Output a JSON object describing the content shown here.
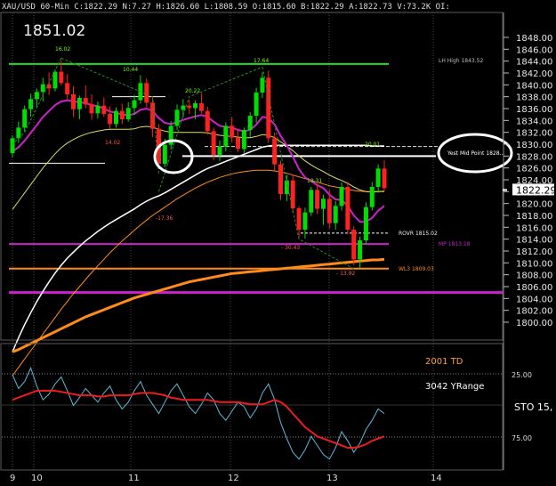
{
  "header": {
    "text": "XAU/USD 60-Min C:1822.29 N:7.27 H:1826.60 L:1808.59 O:1815.60 B:1822.29 A:1822.73 V:73.2K OI: ",
    "big_price": "1851.02"
  },
  "colors": {
    "background": "#000000",
    "candle_up": "#00dd00",
    "candle_down": "#ff2020",
    "price_label_bg": "#ffffff",
    "magenta": "#cc22cc",
    "green_line": "#22dd22",
    "orange": "#ff8c1a"
  },
  "chart_data": [
    {
      "type": "line",
      "ylim": [
        1798,
        1849
      ],
      "y_ticks": [
        "1848.00",
        "1846.00",
        "1844.00",
        "1842.00",
        "1840.00",
        "1838.00",
        "1836.00",
        "1834.00",
        "1832.00",
        "1830.00",
        "1828.00",
        "1826.00",
        "1824.00",
        "1822.00",
        "1820.00",
        "1818.00",
        "1816.00",
        "1814.00",
        "1812.00",
        "1810.00",
        "1808.00",
        "1806.00",
        "1804.00",
        "1802.00",
        "1800.00"
      ],
      "current_price": "1822.29",
      "x_ticks": [
        "9",
        "10",
        "11",
        "12",
        "13",
        "14"
      ],
      "candles": [
        [
          1828.5,
          1831.5,
          1827.8,
          1831.0
        ],
        [
          1831.0,
          1833.8,
          1830.2,
          1832.8
        ],
        [
          1832.8,
          1836.5,
          1832.1,
          1835.9
        ],
        [
          1835.9,
          1838.5,
          1834.6,
          1837.6
        ],
        [
          1837.6,
          1839.4,
          1836.1,
          1838.8
        ],
        [
          1838.8,
          1841.2,
          1837.2,
          1840.1
        ],
        [
          1840.1,
          1842.1,
          1838.3,
          1839.4
        ],
        [
          1839.4,
          1842.6,
          1838.9,
          1842.2
        ],
        [
          1842.2,
          1844.1,
          1839.9,
          1840.3
        ],
        [
          1840.3,
          1841.8,
          1837.6,
          1838.4
        ],
        [
          1838.4,
          1839.8,
          1834.6,
          1835.9
        ],
        [
          1835.9,
          1838.2,
          1834.2,
          1837.8
        ],
        [
          1837.8,
          1839.9,
          1836.1,
          1836.7
        ],
        [
          1836.7,
          1838.4,
          1834.1,
          1835.2
        ],
        [
          1835.2,
          1837.2,
          1834.3,
          1836.5
        ],
        [
          1836.5,
          1837.9,
          1834.6,
          1835.1
        ],
        [
          1835.1,
          1836.4,
          1832.6,
          1833.4
        ],
        [
          1833.4,
          1836.2,
          1832.8,
          1835.6
        ],
        [
          1835.6,
          1836.8,
          1833.4,
          1834.2
        ],
        [
          1834.2,
          1837.1,
          1833.8,
          1836.1
        ],
        [
          1836.1,
          1838.3,
          1834.9,
          1837.4
        ],
        [
          1837.4,
          1841.6,
          1836.8,
          1840.3
        ],
        [
          1840.3,
          1841.1,
          1836.2,
          1837.0
        ],
        [
          1837.0,
          1838.0,
          1831.2,
          1832.6
        ],
        [
          1832.6,
          1833.4,
          1825.8,
          1826.7
        ],
        [
          1826.7,
          1830.9,
          1826.1,
          1829.9
        ],
        [
          1829.9,
          1833.9,
          1829.1,
          1833.1
        ],
        [
          1833.1,
          1836.7,
          1832.4,
          1835.8
        ],
        [
          1835.8,
          1837.6,
          1834.5,
          1836.5
        ],
        [
          1836.5,
          1837.5,
          1835.1,
          1836.1
        ],
        [
          1836.1,
          1837.4,
          1834.2,
          1836.9
        ],
        [
          1836.9,
          1838.6,
          1835.2,
          1835.6
        ],
        [
          1835.6,
          1836.3,
          1831.6,
          1832.2
        ],
        [
          1832.2,
          1832.8,
          1827.3,
          1828.2
        ],
        [
          1828.2,
          1830.6,
          1827.2,
          1829.6
        ],
        [
          1829.6,
          1833.7,
          1828.8,
          1833.1
        ],
        [
          1833.1,
          1834.6,
          1830.3,
          1831.1
        ],
        [
          1831.1,
          1832.6,
          1828.7,
          1829.2
        ],
        [
          1829.2,
          1832.8,
          1828.5,
          1832.4
        ],
        [
          1832.4,
          1835.4,
          1831.2,
          1834.8
        ],
        [
          1834.8,
          1839.5,
          1833.6,
          1838.7
        ],
        [
          1838.7,
          1842.1,
          1837.8,
          1841.2
        ],
        [
          1841.2,
          1842.4,
          1830.2,
          1831.0
        ],
        [
          1831.0,
          1832.0,
          1825.6,
          1826.6
        ],
        [
          1826.6,
          1827.2,
          1820.6,
          1821.6
        ],
        [
          1821.6,
          1824.8,
          1820.4,
          1823.9
        ],
        [
          1823.9,
          1824.9,
          1818.4,
          1819.2
        ],
        [
          1819.2,
          1819.6,
          1814.3,
          1815.6
        ],
        [
          1815.6,
          1819.3,
          1814.1,
          1818.5
        ],
        [
          1818.5,
          1822.8,
          1817.9,
          1822.3
        ],
        [
          1822.3,
          1823.4,
          1818.2,
          1819.1
        ],
        [
          1819.1,
          1821.5,
          1816.4,
          1820.8
        ],
        [
          1820.8,
          1822.3,
          1815.8,
          1816.7
        ],
        [
          1816.7,
          1820.4,
          1815.6,
          1819.6
        ],
        [
          1819.6,
          1823.6,
          1818.8,
          1822.8
        ],
        [
          1822.8,
          1823.6,
          1814.8,
          1815.6
        ],
        [
          1815.6,
          1816.2,
          1809.6,
          1810.6
        ],
        [
          1810.6,
          1814.4,
          1809.1,
          1813.8
        ],
        [
          1813.8,
          1820.2,
          1813.1,
          1819.4
        ],
        [
          1819.4,
          1823.6,
          1818.8,
          1822.8
        ],
        [
          1822.8,
          1826.6,
          1821.8,
          1825.9
        ],
        [
          1825.9,
          1827.3,
          1822.1,
          1822.6
        ]
      ],
      "indicators": {
        "ma_magenta": [
          1828.8,
          1829.5,
          1830.6,
          1831.9,
          1833.2,
          1834.6,
          1835.6,
          1836.6,
          1837.2,
          1837.4,
          1837.2,
          1837.1,
          1836.9,
          1836.6,
          1836.4,
          1836.0,
          1835.5,
          1835.3,
          1835.0,
          1834.9,
          1835.1,
          1835.8,
          1836.0,
          1835.6,
          1834.4,
          1833.6,
          1833.4,
          1833.7,
          1834.1,
          1834.4,
          1834.7,
          1834.9,
          1834.6,
          1833.8,
          1833.1,
          1832.9,
          1832.8,
          1832.4,
          1832.2,
          1832.4,
          1833.3,
          1834.6,
          1834.4,
          1833.3,
          1831.4,
          1829.8,
          1827.9,
          1825.8,
          1824.4,
          1823.8,
          1823.1,
          1822.6,
          1821.5,
          1820.7,
          1820.6,
          1819.6,
          1818.0,
          1816.9,
          1816.9,
          1817.6,
          1818.8,
          1819.6
        ],
        "ma_yellow": [
          1819.0,
          1820.4,
          1821.8,
          1823.2,
          1824.6,
          1826.0,
          1827.2,
          1828.4,
          1829.4,
          1830.2,
          1830.8,
          1831.3,
          1831.7,
          1832.0,
          1832.2,
          1832.4,
          1832.5,
          1832.5,
          1832.5,
          1832.5,
          1832.6,
          1832.9,
          1833.0,
          1832.9,
          1832.5,
          1832.2,
          1832.0,
          1832.0,
          1832.0,
          1832.0,
          1832.0,
          1832.0,
          1831.9,
          1831.7,
          1831.5,
          1831.4,
          1831.3,
          1831.2,
          1831.1,
          1831.1,
          1831.3,
          1831.6,
          1831.5,
          1831.1,
          1830.4,
          1829.7,
          1828.9,
          1828.0,
          1827.2,
          1826.5,
          1825.9,
          1825.4,
          1824.8,
          1824.3,
          1823.9,
          1823.4,
          1822.8,
          1822.3,
          1822.0,
          1821.9,
          1822.0,
          1822.1
        ],
        "ma_white": [
          1795.0,
          1797.4,
          1799.6,
          1801.6,
          1803.5,
          1805.2,
          1806.8,
          1808.3,
          1809.6,
          1810.8,
          1811.8,
          1812.8,
          1813.7,
          1814.5,
          1815.3,
          1816.0,
          1816.7,
          1817.3,
          1817.9,
          1818.5,
          1819.1,
          1819.8,
          1820.4,
          1820.9,
          1821.3,
          1821.8,
          1822.4,
          1823.0,
          1823.6,
          1824.2,
          1824.8,
          1825.4,
          1825.9,
          1826.3,
          1826.7,
          1827.1,
          1827.5,
          1827.9,
          1828.3,
          1828.7,
          1829.1,
          1829.5,
          1829.7,
          1829.8,
          1829.8,
          1829.8,
          1829.8,
          1829.8,
          1829.8,
          1829.8,
          1829.8,
          1829.8,
          1829.8,
          1829.8,
          1829.8,
          1829.8,
          1829.8,
          1829.8,
          1829.8,
          1829.7,
          1829.7,
          1829.7
        ],
        "ma_orange_thin": [
          1791.0,
          1792.4,
          1793.8,
          1795.2,
          1796.6,
          1798.0,
          1799.4,
          1800.8,
          1802.2,
          1803.5,
          1804.8,
          1806.0,
          1807.2,
          1808.4,
          1809.5,
          1810.6,
          1811.7,
          1812.7,
          1813.7,
          1814.6,
          1815.5,
          1816.4,
          1817.2,
          1818.0,
          1818.7,
          1819.4,
          1820.1,
          1820.8,
          1821.4,
          1822.0,
          1822.6,
          1823.1,
          1823.6,
          1824.0,
          1824.4,
          1824.7,
          1825.0,
          1825.2,
          1825.4,
          1825.5,
          1825.6,
          1825.6,
          1825.6,
          1825.5,
          1825.3,
          1825.1,
          1824.8,
          1824.5,
          1824.2,
          1823.9,
          1823.6,
          1823.3,
          1823.0,
          1822.8,
          1822.6,
          1822.4,
          1822.2,
          1822.1,
          1822.0,
          1822.0,
          1822.0,
          1822.0
        ],
        "ma_orange_thick": [
          1795.0,
          1795.4,
          1795.9,
          1796.4,
          1796.9,
          1797.4,
          1797.9,
          1798.4,
          1798.9,
          1799.4,
          1799.9,
          1800.4,
          1800.9,
          1801.3,
          1801.7,
          1802.1,
          1802.5,
          1802.9,
          1803.3,
          1803.7,
          1804.1,
          1804.4,
          1804.7,
          1805.0,
          1805.3,
          1805.6,
          1805.9,
          1806.2,
          1806.5,
          1806.8,
          1807.0,
          1807.2,
          1807.4,
          1807.6,
          1807.8,
          1808.0,
          1808.2,
          1808.3,
          1808.4,
          1808.5,
          1808.6,
          1808.7,
          1808.8,
          1808.9,
          1809.0,
          1809.1,
          1809.2,
          1809.3,
          1809.4,
          1809.5,
          1809.6,
          1809.7,
          1809.8,
          1809.9,
          1810.0,
          1810.1,
          1810.2,
          1810.3,
          1810.4,
          1810.5,
          1810.5,
          1810.6
        ]
      },
      "levels": [
        {
          "price": 1843.52,
          "label": "LH High 1843.52",
          "color": "#22dd22"
        },
        {
          "price": 1828.0,
          "label": "Yest Mid Point 1828...",
          "color": "#ffffff"
        },
        {
          "price": 1815.02,
          "label": "ROVR 1815.02",
          "color": "#ffffff"
        },
        {
          "price": 1813.18,
          "label": "MP 1813.18",
          "color": "#cc22cc"
        },
        {
          "price": 1809.03,
          "label": "WL3 1809.03",
          "color": "#ff8c1a"
        },
        {
          "price": 1805.0,
          "label": "",
          "color": "#cc22cc"
        }
      ],
      "annotations": [
        "16.02",
        "10.44",
        "20.22",
        "17.64",
        "14.02",
        "20.01",
        "18.31",
        "- 30.43",
        "- 13.92",
        "-17.36"
      ]
    },
    {
      "type": "line",
      "title": "STO 15,",
      "ylim": [
        0,
        100
      ],
      "y_ticks": [
        "25.00",
        "75.00"
      ],
      "series": [
        {
          "name": "",
          "values": [
            82,
            70,
            76,
            88,
            72,
            60,
            65,
            74,
            80,
            68,
            55,
            62,
            70,
            64,
            58,
            66,
            72,
            60,
            52,
            58,
            68,
            76,
            64,
            56,
            48,
            58,
            68,
            74,
            64,
            54,
            48,
            56,
            66,
            60,
            48,
            42,
            50,
            58,
            54,
            44,
            52,
            66,
            74,
            60,
            40,
            26,
            14,
            8,
            16,
            28,
            20,
            12,
            8,
            18,
            32,
            24,
            14,
            22,
            34,
            42,
            52,
            48
          ]
        },
        {
          "name": "",
          "values": [
            60,
            62,
            64,
            66,
            68,
            68,
            68,
            68,
            67,
            66,
            65,
            64,
            64,
            64,
            63,
            63,
            64,
            64,
            64,
            64,
            65,
            66,
            66,
            66,
            65,
            64,
            62,
            61,
            60,
            60,
            60,
            60,
            60,
            59,
            58,
            58,
            58,
            58,
            57,
            56,
            56,
            56,
            58,
            60,
            58,
            54,
            48,
            42,
            36,
            32,
            28,
            26,
            24,
            22,
            20,
            18,
            18,
            19,
            21,
            24,
            26,
            28
          ]
        }
      ],
      "labels": [
        "2001 TD",
        "3042 YRange"
      ]
    }
  ]
}
